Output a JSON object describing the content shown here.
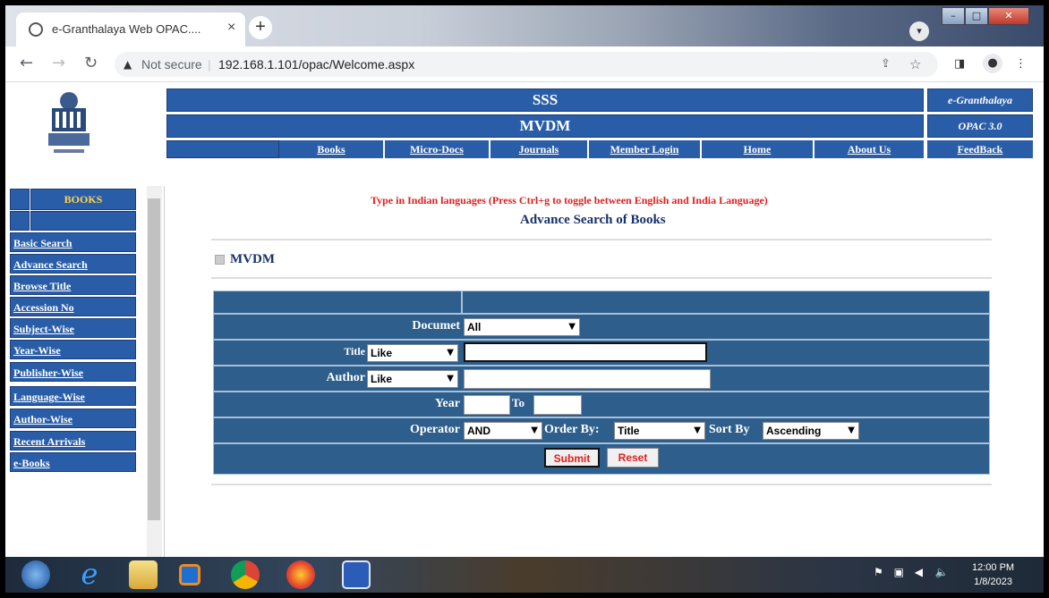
{
  "browser": {
    "tab_title": "e-Granthalaya Web OPAC....",
    "not_secure": "Not secure",
    "url": "192.168.1.101/opac/Welcome.aspx"
  },
  "header": {
    "org": "SSS",
    "unit": "MVDM",
    "brand": "e-Granthalaya",
    "version": "OPAC 3.0",
    "nav": [
      "Books",
      "Micro-Docs",
      "Journals",
      "Member Login",
      "Home",
      "About Us",
      "FeedBack"
    ]
  },
  "sidebar": {
    "title": "BOOKS",
    "items": [
      "Basic Search",
      "Advance Search",
      "Browse Title",
      "Accession No",
      "Subject-Wise",
      "Year-Wise",
      "Publisher-Wise",
      "Language-Wise",
      "Author-Wise",
      "Recent Arrivals",
      "e-Books"
    ]
  },
  "main": {
    "hint": "Type in Indian languages (Press Ctrl+g to toggle between English and India Language)",
    "heading": "Advance Search of Books",
    "library": "MVDM"
  },
  "form": {
    "document_label": "Documet",
    "document_value": "All",
    "title_label": "Title",
    "title_mode": "Like",
    "author_label": "Author",
    "author_mode": "Like",
    "year_label": "Year",
    "to_label": "To",
    "operator_label": "Operator",
    "operator_value": "AND",
    "orderby_label": "Order By:",
    "orderby_value": "Title",
    "sortby_label": "Sort By",
    "sortby_value": "Ascending",
    "submit": "Submit",
    "reset": "Reset"
  },
  "taskbar": {
    "time": "12:00 PM",
    "date": "1/8/2023"
  },
  "colors": {
    "bar_blue": "#2a5da8",
    "form_blue": "#2e5e8c",
    "hint_red": "#e02020",
    "heading_navy": "#16326b"
  },
  "icons": [
    "globe-icon",
    "close-icon",
    "plus-icon",
    "back-icon",
    "forward-icon",
    "reload-icon",
    "warning-icon",
    "share-icon",
    "star-icon",
    "sidepanel-icon",
    "profile-icon",
    "menu-icon",
    "chevron-down-icon",
    "windows-start-icon",
    "ie-icon",
    "folder-icon",
    "media-icon",
    "chrome-icon",
    "firefox-icon",
    "word-icon",
    "flag-icon",
    "network-icon",
    "volume-icon"
  ]
}
